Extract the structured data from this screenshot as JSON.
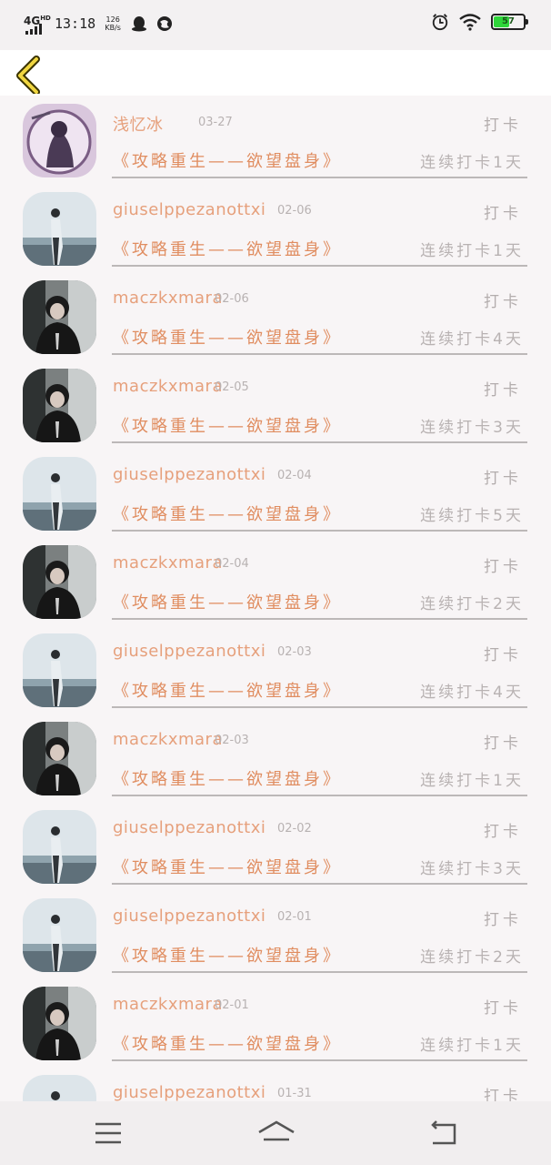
{
  "status_bar": {
    "network": "4G",
    "network_sup": "HD",
    "time": "13:18",
    "speed_value": "126",
    "speed_unit": "KB/s",
    "battery_level": "57",
    "icons": [
      "qq-icon",
      "browser-icon",
      "alarm-icon",
      "wifi-icon",
      "battery-icon"
    ]
  },
  "header": {
    "back_icon": "chevron-left-icon",
    "accent": "#f0d640"
  },
  "list": {
    "checkin_label": "打卡",
    "items": [
      {
        "name": "浅忆冰",
        "date": "03-27",
        "book": "《攻略重生——欲望盘身》",
        "streak": "连续打卡1天",
        "avatar": "anime"
      },
      {
        "name": "giuselppezanottxi",
        "date": "02-06",
        "book": "《攻略重生——欲望盘身》",
        "streak": "连续打卡1天",
        "avatar": "light"
      },
      {
        "name": "maczkxmara",
        "date": "02-06",
        "book": "《攻略重生——欲望盘身》",
        "streak": "连续打卡4天",
        "avatar": "dark"
      },
      {
        "name": "maczkxmara",
        "date": "02-05",
        "book": "《攻略重生——欲望盘身》",
        "streak": "连续打卡3天",
        "avatar": "dark"
      },
      {
        "name": "giuselppezanottxi",
        "date": "02-04",
        "book": "《攻略重生——欲望盘身》",
        "streak": "连续打卡5天",
        "avatar": "light"
      },
      {
        "name": "maczkxmara",
        "date": "02-04",
        "book": "《攻略重生——欲望盘身》",
        "streak": "连续打卡2天",
        "avatar": "dark"
      },
      {
        "name": "giuselppezanottxi",
        "date": "02-03",
        "book": "《攻略重生——欲望盘身》",
        "streak": "连续打卡4天",
        "avatar": "light"
      },
      {
        "name": "maczkxmara",
        "date": "02-03",
        "book": "《攻略重生——欲望盘身》",
        "streak": "连续打卡1天",
        "avatar": "dark"
      },
      {
        "name": "giuselppezanottxi",
        "date": "02-02",
        "book": "《攻略重生——欲望盘身》",
        "streak": "连续打卡3天",
        "avatar": "light"
      },
      {
        "name": "giuselppezanottxi",
        "date": "02-01",
        "book": "《攻略重生——欲望盘身》",
        "streak": "连续打卡2天",
        "avatar": "light"
      },
      {
        "name": "maczkxmara",
        "date": "02-01",
        "book": "《攻略重生——欲望盘身》",
        "streak": "连续打卡1天",
        "avatar": "dark"
      },
      {
        "name": "giuselppezanottxi",
        "date": "01-31",
        "book": "",
        "streak": "",
        "avatar": "light"
      }
    ]
  },
  "nav_bar": {
    "icons": [
      "menu-icon",
      "home-icon",
      "back-icon"
    ]
  }
}
